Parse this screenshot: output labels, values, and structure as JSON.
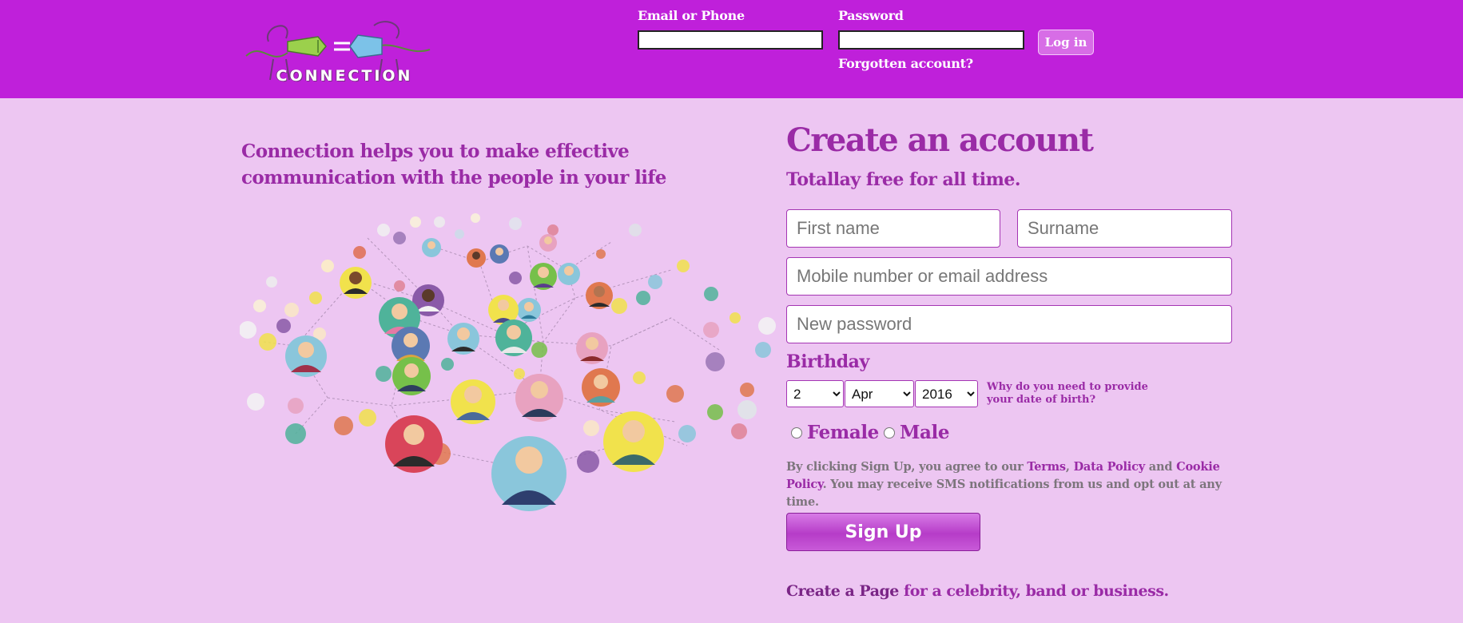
{
  "header": {
    "logo_text": "CONNECTION",
    "email_label": "Email or Phone",
    "password_label": "Password",
    "login_button": "Log in",
    "forgot_link": "Forgotten account?"
  },
  "intro": {
    "tagline": "Connection helps you to make effective communication with the people in your life"
  },
  "signup": {
    "title": "Create an account",
    "subtitle": "Totallay free for all time.",
    "first_name_placeholder": "First name",
    "surname_placeholder": "Surname",
    "contact_placeholder": "Mobile number or email address",
    "password_placeholder": "New password",
    "birthday_label": "Birthday",
    "birthday": {
      "day": "2",
      "month": "Apr",
      "year": "2016"
    },
    "why_link": "Why do you need to provide your date of birth?",
    "gender_female": "Female",
    "gender_male": "Male",
    "terms_prefix": "By clicking Sign Up, you agree to our ",
    "terms_link": "Terms",
    "terms_sep1": ", ",
    "data_policy_link": "Data Policy",
    "terms_and": " and ",
    "cookie_policy_link": "Cookie Policy",
    "terms_suffix": ". You may receive SMS notifications from us and opt out at any time.",
    "signup_button": "Sign Up",
    "create_page_link": "Create a Page",
    "create_page_suffix": " for a celebrity, band or business."
  },
  "colors": {
    "header_bg": "#bf20da",
    "page_bg": "#edc6f2",
    "accent_text": "#9a2ba6"
  }
}
